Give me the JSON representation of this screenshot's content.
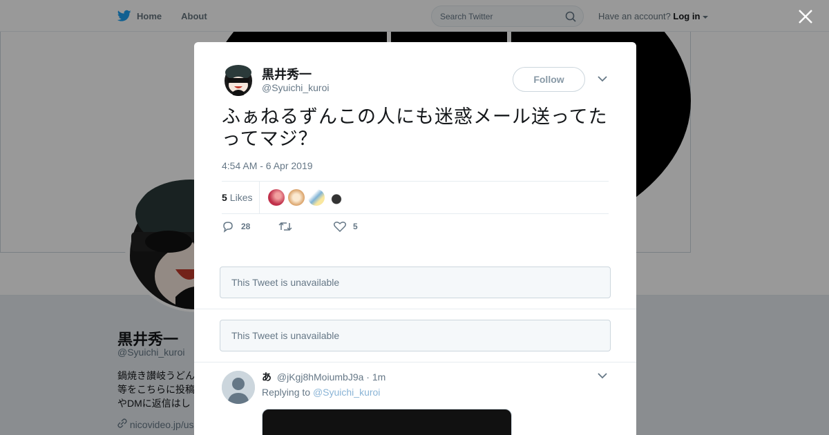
{
  "nav": {
    "home": "Home",
    "about": "About",
    "search_placeholder": "Search Twitter",
    "account_prompt": "Have an account?",
    "login": "Log in"
  },
  "profile": {
    "name": "黒井秀一",
    "handle": "@Syuichi_kuroi",
    "bio": "鍋焼き讃岐うどん\n等をこちらに投稿\nやDMに返信はし",
    "link": "nicovideo.jp/us"
  },
  "tweet": {
    "name": "黒井秀一",
    "handle": "@Syuichi_kuroi",
    "follow_label": "Follow",
    "text": "ふぁねるずんこの人にも迷惑メール送ってたってマジ？",
    "timestamp": "4:54 AM - 6 Apr 2019",
    "likes_count": "5",
    "likes_label": "Likes",
    "reply_count": "28",
    "retweet_count": "",
    "like_count": "5"
  },
  "unavailable": [
    "This Tweet is unavailable",
    "This Tweet is unavailable"
  ],
  "reply": {
    "name": "あ",
    "handle": "@jKgj8hMoiumbJ9a",
    "time": "· 1m",
    "replying_prefix": "Replying to",
    "replying_to": "@Syuichi_kuroi"
  },
  "colors": {
    "brand": "#1da1f2",
    "overlay": "rgba(0,0,0,0.4)",
    "muted": "#657786"
  },
  "icons": [
    "twitter-bird-icon",
    "home-icon",
    "search-icon",
    "caret-down-icon",
    "close-icon",
    "reply-icon",
    "retweet-icon",
    "heart-icon",
    "link-icon"
  ]
}
